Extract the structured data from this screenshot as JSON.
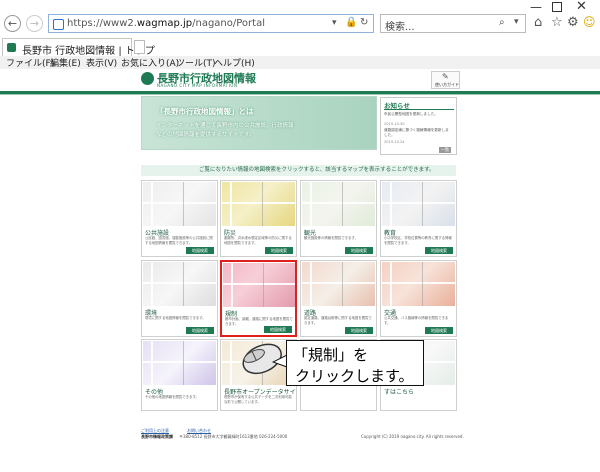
{
  "browser": {
    "url_prefix": "https://www2.",
    "url_domain": "wagmap.jp",
    "url_suffix": "/nagano/Portal",
    "search_placeholder": "検索...",
    "tab_title": "長野市 行政地図情報 | トップ",
    "menu": [
      "ファイル(F)",
      "編集(E)",
      "表示(V)",
      "お気に入り(A)",
      "ツール(T)",
      "ヘルプ(H)"
    ]
  },
  "site": {
    "title": "長野市行政地図情報",
    "subtitle": "NAGANO CITY MAP INFORMATION",
    "help_label": "使い方ガイド"
  },
  "banner": {
    "heading": "「長野市行政地図情報」とは",
    "line1": "インターネットを通じて長野市内の公共施設、行政情報",
    "line2": "などの地図情報を提供するサイトです。"
  },
  "news": {
    "title": "お知らせ",
    "items": [
      "市民公開型地図を更新しました。",
      "2019.10.30",
      "道路認定線に基づく路線情報を更新しました。",
      "2019.10.24"
    ],
    "more": "一覧"
  },
  "instruction": "ご覧になりたい情報の地図検索をクリックすると、該当するマップを表示することができます。",
  "cards": [
    {
      "title": "公共施設",
      "desc": "公民館、図書館、運動施設等の公共施設に関する地図情報を閲覧できます。",
      "btn": "地図検索"
    },
    {
      "title": "防災",
      "desc": "避難所、洪水浸水想定区域等の防災に関する地図を閲覧できます。",
      "btn": "地図検索"
    },
    {
      "title": "観光",
      "desc": "観光施設等の情報を閲覧できます。",
      "btn": "地図検索"
    },
    {
      "title": "教育",
      "desc": "小中学校区、学校位置等の教育に関する情報を閲覧できます。",
      "btn": "地図検索"
    },
    {
      "title": "環境",
      "desc": "環境に関する地図情報を閲覧できます。",
      "btn": "地図検索"
    },
    {
      "title": "規制",
      "desc": "都市計画、景観、道路に関する地図を閲覧できます。",
      "btn": "地図検索"
    },
    {
      "title": "道路",
      "desc": "認定道路、道路台帳等に関する地図を閲覧できます。",
      "btn": "地図検索"
    },
    {
      "title": "交通",
      "desc": "公共交通、バス路線等の情報を閲覧できます。",
      "btn": "地図検索"
    },
    {
      "title": "その他",
      "desc": "その他の地図情報を閲覧できます。",
      "btn": ""
    },
    {
      "title": "長野市オープンデータサイト",
      "desc": "長野市が保有する公共データを二次利用可能な形で公開しています。",
      "btn": ""
    },
    {
      "title": "",
      "desc": "",
      "btn": ""
    },
    {
      "title": "すはこちら",
      "desc": "",
      "btn": ""
    }
  ],
  "footer": {
    "link1": "ご利用上の注意",
    "link2": "お問い合わせ",
    "dept": "長野市情報政策課",
    "address": "〒380-8512 長野市大字鶴賀緑町1613番地 026-224-5000",
    "copyright": "Copyright (C) 2019 nagano city. All rights reserved."
  },
  "callout": {
    "line1": "「規制」を",
    "line2": "クリックします。"
  },
  "colors": {
    "brand_green": "#1f7a54",
    "highlight_red": "#e0201c"
  }
}
